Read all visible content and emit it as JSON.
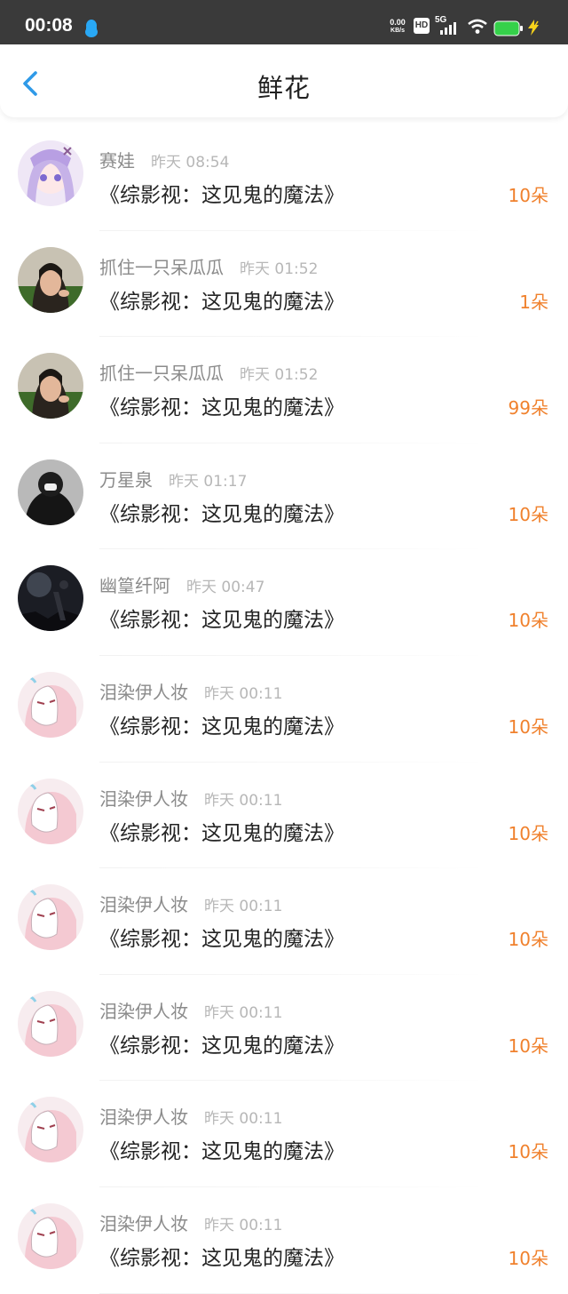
{
  "status_bar": {
    "time": "00:08",
    "net_speed_value": "0.00",
    "net_speed_unit": "KB/s",
    "hd_label": "HD",
    "network_label": "5G"
  },
  "header": {
    "title": "鲜花"
  },
  "colors": {
    "accent_blue": "#2f9ae8",
    "flower_orange": "#f0812d",
    "battery_green": "#35d14a"
  },
  "items": [
    {
      "avatar": "anime-girl-purple-hair",
      "user": "赛娃",
      "time": "昨天 08:54",
      "book": "《综影视：这见鬼的魔法》",
      "flowers": "10朵"
    },
    {
      "avatar": "girl-photo",
      "user": "抓住一只呆瓜瓜",
      "time": "昨天 01:52",
      "book": "《综影视：这见鬼的魔法》",
      "flowers": "1朵"
    },
    {
      "avatar": "girl-photo",
      "user": "抓住一只呆瓜瓜",
      "time": "昨天 01:52",
      "book": "《综影视：这见鬼的魔法》",
      "flowers": "99朵"
    },
    {
      "avatar": "person-black-mask",
      "user": "万星泉",
      "time": "昨天 01:17",
      "book": "《综影视：这见鬼的魔法》",
      "flowers": "10朵"
    },
    {
      "avatar": "dark-night-scene",
      "user": "幽篁纤阿",
      "time": "昨天 00:47",
      "book": "《综影视：这见鬼的魔法》",
      "flowers": "10朵"
    },
    {
      "avatar": "anime-fox-mask",
      "user": "泪染伊人妆",
      "time": "昨天 00:11",
      "book": "《综影视：这见鬼的魔法》",
      "flowers": "10朵"
    },
    {
      "avatar": "anime-fox-mask",
      "user": "泪染伊人妆",
      "time": "昨天 00:11",
      "book": "《综影视：这见鬼的魔法》",
      "flowers": "10朵"
    },
    {
      "avatar": "anime-fox-mask",
      "user": "泪染伊人妆",
      "time": "昨天 00:11",
      "book": "《综影视：这见鬼的魔法》",
      "flowers": "10朵"
    },
    {
      "avatar": "anime-fox-mask",
      "user": "泪染伊人妆",
      "time": "昨天 00:11",
      "book": "《综影视：这见鬼的魔法》",
      "flowers": "10朵"
    },
    {
      "avatar": "anime-fox-mask",
      "user": "泪染伊人妆",
      "time": "昨天 00:11",
      "book": "《综影视：这见鬼的魔法》",
      "flowers": "10朵"
    },
    {
      "avatar": "anime-fox-mask",
      "user": "泪染伊人妆",
      "time": "昨天 00:11",
      "book": "《综影视：这见鬼的魔法》",
      "flowers": "10朵"
    }
  ]
}
